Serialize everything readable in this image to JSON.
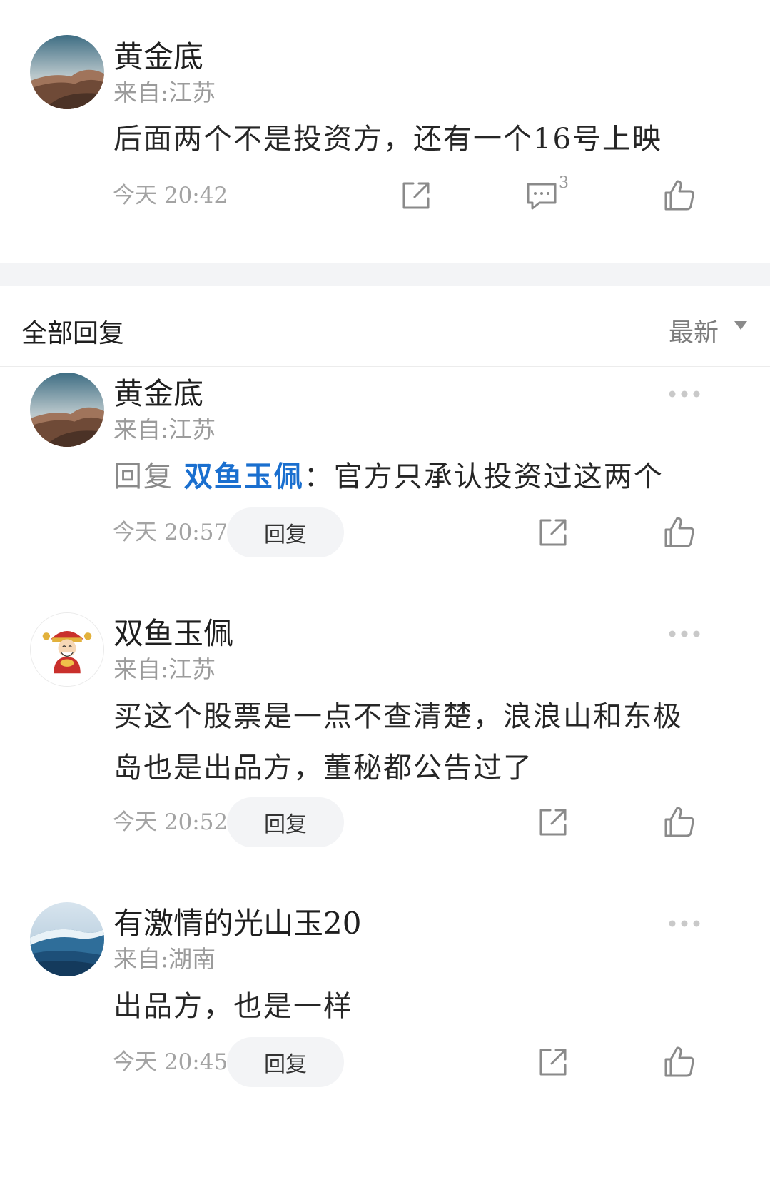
{
  "main_comment": {
    "user": "黄金底",
    "location": "来自:江苏",
    "text": "后面两个不是投资方，还有一个16号上映",
    "time": "今天 20:42",
    "reply_count": "3"
  },
  "section": {
    "title": "全部回复",
    "sort_label": "最新"
  },
  "replies": [
    {
      "user": "黄金底",
      "location": "来自:江苏",
      "reply_prefix": "回复",
      "mention": "双鱼玉佩",
      "text": "：官方只承认投资过这两个",
      "time": "今天 20:57",
      "reply_button": "回复"
    },
    {
      "user": "双鱼玉佩",
      "location": "来自:江苏",
      "text": "买这个股票是一点不查清楚，浪浪山和东极岛也是出品方，董秘都公告过了",
      "time": "今天 20:52",
      "reply_button": "回复"
    },
    {
      "user": "有激情的光山玉20",
      "location": "来自:湖南",
      "text": "出品方，也是一样",
      "time": "今天 20:45",
      "reply_button": "回复"
    }
  ],
  "icons": {
    "share": "share-icon",
    "comment": "comment-icon",
    "like": "thumbs-up-icon",
    "more": "more-icon",
    "sort": "caret-down-icon"
  },
  "colors": {
    "mention": "#1a6fcf",
    "secondary_text": "#9b9b9b",
    "button_bg": "#f3f4f6"
  }
}
